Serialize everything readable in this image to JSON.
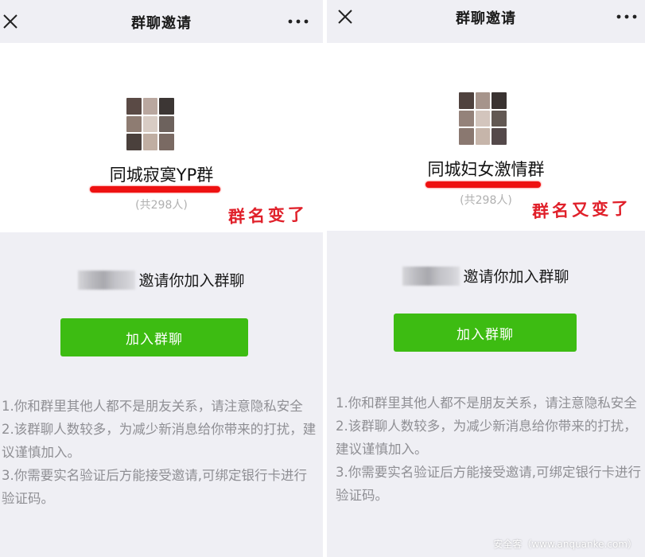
{
  "left_screen": {
    "nav": {
      "title": "群聊邀请",
      "close_icon": "close-icon",
      "more_icon": "more-icon"
    },
    "group": {
      "name": "同城寂寞YP群",
      "member_count": "(共298人)",
      "avatar_colors": [
        "#5a4a45",
        "#b9a79f",
        "#3c3634",
        "#8e7c72",
        "#d8ccc4",
        "#6d625d",
        "#4a403c",
        "#c0aea2",
        "#7a6a63"
      ]
    },
    "annotation": "群名变了",
    "invite_text": "邀请你加入群聊",
    "join_button": "加入群聊",
    "notes": [
      "1.你和群里其他人都不是朋友关系，请注意隐私安全",
      "2.该群聊人数较多，为减少新消息给你带来的打扰，建议谨慎加入。",
      "3.你需要实名验证后方能接受邀请,可绑定银行卡进行验证码。"
    ]
  },
  "right_screen": {
    "nav": {
      "title": "群聊邀请",
      "close_icon": "close-icon",
      "more_icon": "more-icon"
    },
    "group": {
      "name": "同城妇女激情群",
      "member_count": "(共298人)",
      "avatar_colors": [
        "#4f423e",
        "#a6948b",
        "#3a3331",
        "#94827a",
        "#d3c5bd",
        "#625853",
        "#8a7870",
        "#c6b5aa",
        "#54494a"
      ]
    },
    "annotation": "群名又变了",
    "invite_text": "邀请你加入群聊",
    "join_button": "加入群聊",
    "notes": [
      "1.你和群里其他人都不是朋友关系，请注意隐私安全",
      "2.该群聊人数较多，为减少新消息给你带来的打扰，建议谨慎加入。",
      "3.你需要实名验证后方能接受邀请,可绑定银行卡进行验证码。"
    ]
  },
  "watermark": "安全客（www.anquanke.com）",
  "colors": {
    "accent_green": "#3dbc12",
    "annotation_red": "#e0202a",
    "background": "#efeff4"
  }
}
